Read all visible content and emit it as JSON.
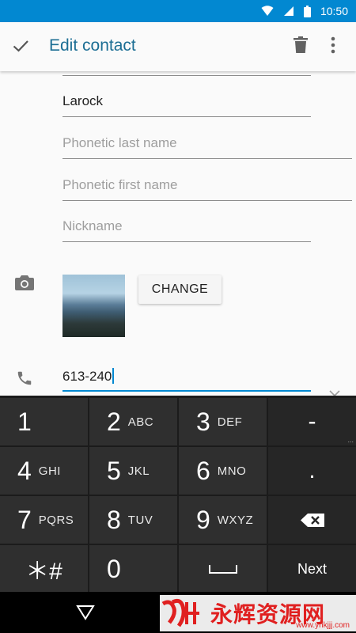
{
  "status_bar": {
    "time": "10:50"
  },
  "app_bar": {
    "title": "Edit contact"
  },
  "form": {
    "last_name": {
      "value": "Larock"
    },
    "phonetic_last_name": {
      "placeholder": "Phonetic last name"
    },
    "phonetic_first_name": {
      "placeholder": "Phonetic first name"
    },
    "nickname": {
      "placeholder": "Nickname"
    },
    "photo": {
      "change_label": "CHANGE"
    },
    "phone": {
      "value": "613-240"
    }
  },
  "keyboard": {
    "rows": [
      [
        {
          "main": "1",
          "sub": ""
        },
        {
          "main": "2",
          "sub": "ABC"
        },
        {
          "main": "3",
          "sub": "DEF"
        },
        {
          "main": "-",
          "sub": ""
        }
      ],
      [
        {
          "main": "4",
          "sub": "GHI"
        },
        {
          "main": "5",
          "sub": "JKL"
        },
        {
          "main": "6",
          "sub": "MNO"
        },
        {
          "main": ".",
          "sub": ""
        }
      ],
      [
        {
          "main": "7",
          "sub": "PQRS"
        },
        {
          "main": "8",
          "sub": "TUV"
        },
        {
          "main": "9",
          "sub": "WXYZ"
        },
        {
          "main": "",
          "sub": ""
        }
      ],
      [
        {
          "main": "＊#",
          "sub": ""
        },
        {
          "main": "0",
          "sub": ""
        },
        {
          "main": "",
          "sub": ""
        },
        {
          "main": "Next",
          "sub": ""
        }
      ]
    ]
  },
  "watermark": {
    "text": "永辉资源网",
    "url": "www.yhkjjj.com"
  },
  "colors": {
    "accent": "#0288d1",
    "title": "#1c6e94"
  },
  "icons": [
    "check-icon",
    "trash-icon",
    "more-icon",
    "camera-icon",
    "phone-icon",
    "backspace-icon",
    "space-icon",
    "back-icon"
  ]
}
